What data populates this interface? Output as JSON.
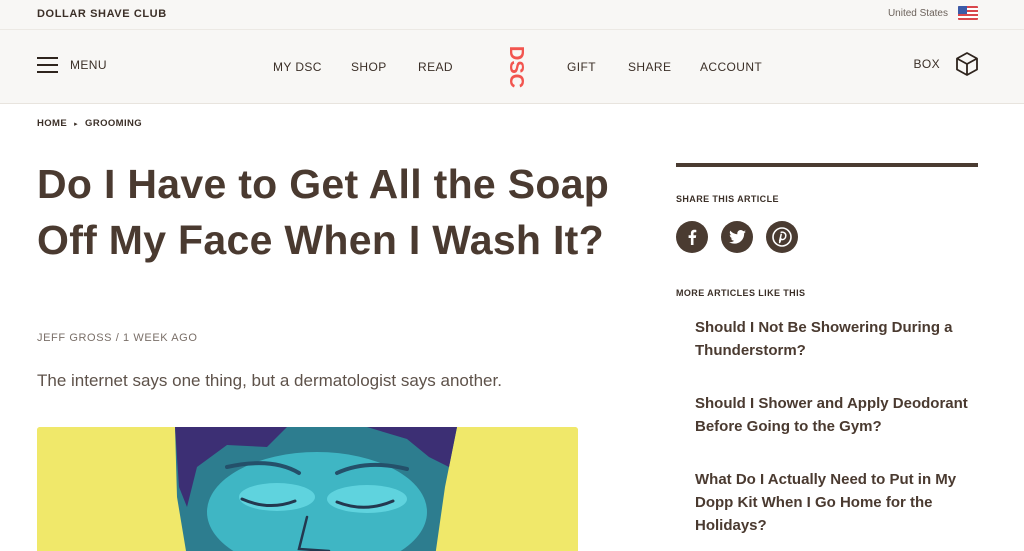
{
  "topbar": {
    "brand": "DOLLAR SHAVE CLUB",
    "locale": "United States",
    "flag_icon": "us-flag-icon"
  },
  "nav": {
    "menu_label": "MENU",
    "links": [
      "MY DSC",
      "SHOP",
      "READ",
      "GIFT",
      "SHARE",
      "ACCOUNT"
    ],
    "logo_text": "DSC",
    "box_label": "BOX",
    "logo_color": "#f2554f"
  },
  "breadcrumb": {
    "home": "HOME",
    "separator": "▸",
    "section": "GROOMING"
  },
  "article": {
    "title": "Do I Have to Get All the Soap Off My Face When I Wash It?",
    "byline": "JEFF GROSS / 1 WEEK AGO",
    "dek": "The internet says one thing, but a dermatologist says another.",
    "hero_bg": "#f0e86a"
  },
  "sidebar": {
    "share_heading": "SHARE THIS ARTICLE",
    "share_icons": [
      "facebook-icon",
      "twitter-icon",
      "pinterest-icon"
    ],
    "more_heading": "MORE ARTICLES LIKE THIS",
    "related": [
      "Should I Not Be Showering During a Thunderstorm?",
      "Should I Shower and Apply Deodorant Before Going to the Gym?",
      "What Do I Actually Need to Put in My Dopp Kit When I Go Home for the Holidays?"
    ]
  }
}
